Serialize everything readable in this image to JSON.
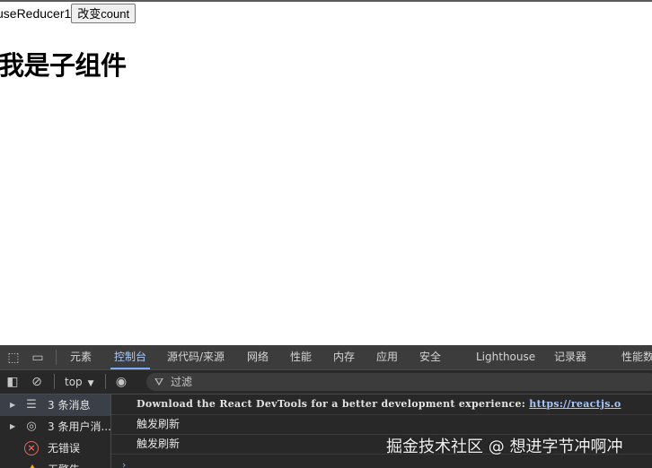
{
  "page": {
    "label_text": "useReducer1",
    "button_label": "改变count",
    "heading": "我是子组件"
  },
  "devtools": {
    "tabs": [
      "元素",
      "控制台",
      "源代码/来源",
      "网络",
      "性能",
      "内存",
      "应用",
      "安全",
      "Lighthouse",
      "记录器",
      "性能数"
    ],
    "active_tab": "控制台",
    "toolbar": {
      "context": "top",
      "filter_placeholder": "过滤"
    },
    "sidebar": [
      {
        "label": "3 条消息",
        "icon": "list-icon",
        "selected": true
      },
      {
        "label": "3 条用户消...",
        "icon": "user-icon",
        "selected": false
      },
      {
        "label": "无错误",
        "icon": "error-icon",
        "selected": false
      },
      {
        "label": "无警告",
        "icon": "warning-icon",
        "selected": false
      }
    ],
    "messages": [
      {
        "text": "Download the React DevTools for a better development experience: ",
        "link": "https://reactjs.o"
      },
      {
        "text": "触发刷新"
      },
      {
        "text": "触发刷新"
      }
    ]
  },
  "watermark": "掘金技术社区 @ 想进字节冲啊冲",
  "colors": {
    "devtools_bg": "#282828",
    "active_tab": "#a9c7fa",
    "link": "#a8c7fa",
    "error": "#e46962",
    "warning": "#f2b600"
  }
}
